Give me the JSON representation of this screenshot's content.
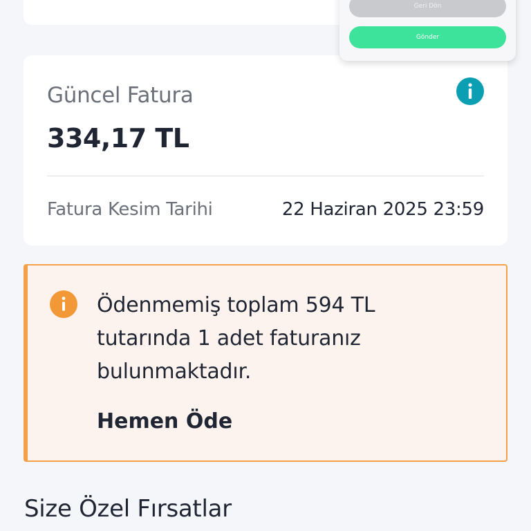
{
  "popup": {
    "back_label": "Geri Dön",
    "send_label": "Gönder"
  },
  "bill": {
    "label": "Güncel Fatura",
    "amount": "334,17 TL",
    "date_label": "Fatura Kesim Tarihi",
    "date_value": "22 Haziran 2025 23:59",
    "info_icon": "info-icon",
    "info_color": "#0c9eb2"
  },
  "warning": {
    "message": "Ödenmemiş toplam 594 TL tutarında 1 adet faturanız bulunmaktadır.",
    "action_label": "Hemen Öde",
    "icon": "exclamation-icon",
    "accent_color": "#f4a048",
    "background_color": "#fdf3ee"
  },
  "section": {
    "title": "Size Özel Fırsatlar"
  },
  "colors": {
    "send_button": "#3ee39b",
    "back_button": "#c9cacd"
  }
}
